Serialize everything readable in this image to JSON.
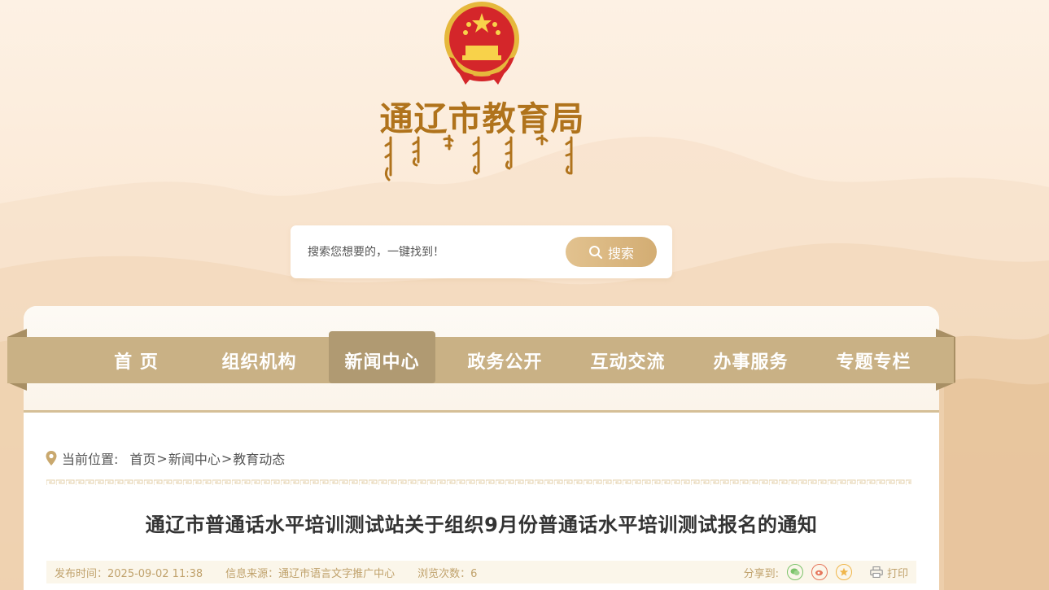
{
  "header": {
    "site_title": "通辽市教育局",
    "emblem_icon": "national-emblem-icon",
    "script_icon": "mongolian-script-icon"
  },
  "search": {
    "placeholder": "搜索您想要的，一键找到！",
    "button_label": "搜索"
  },
  "nav": {
    "items": [
      {
        "label": "首 页"
      },
      {
        "label": "组织机构"
      },
      {
        "label": "新闻中心"
      },
      {
        "label": "政务公开"
      },
      {
        "label": "互动交流"
      },
      {
        "label": "办事服务"
      },
      {
        "label": "专题专栏"
      }
    ],
    "active_index": 2
  },
  "breadcrumb": {
    "label": "当前位置:",
    "items": [
      "首页",
      "新闻中心",
      "教育动态"
    ],
    "separator": ">"
  },
  "article": {
    "title": "通辽市普通话水平培训测试站关于组织9月份普通话水平培训测试报名的通知",
    "publish_time": "发布时间：2025-09-02 11:38",
    "source": "信息来源：通辽市语言文字推广中心",
    "views": "浏览次数：6",
    "share_label": "分享到:",
    "print_label": "打印"
  },
  "colors": {
    "brand_gold": "#b0731c",
    "nav_bg": "#c9b185",
    "nav_active": "#b09a72",
    "meta_text": "#c0a26c"
  }
}
